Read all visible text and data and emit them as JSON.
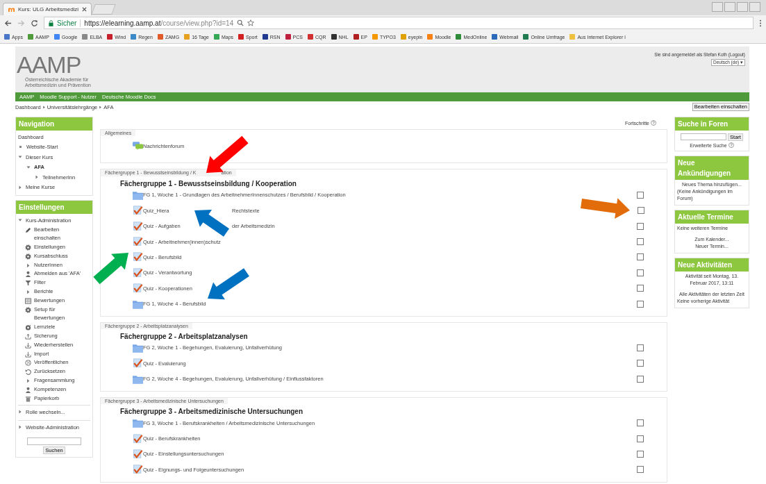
{
  "browser": {
    "tab_title": "Kurs: ULG Arbeitsmedizi",
    "secure_label": "Sicher",
    "url_host": "https://elearning.aamp.at",
    "url_path": "/course/view.php?id=14",
    "bookmarks": [
      {
        "label": "Apps",
        "color": "#4a76c8"
      },
      {
        "label": "AAMP",
        "color": "#4f9a3a"
      },
      {
        "label": "Google",
        "color": "#4285f4"
      },
      {
        "label": "ELBA",
        "color": "#888888"
      },
      {
        "label": "Wind",
        "color": "#c8202a"
      },
      {
        "label": "Regen",
        "color": "#3a8ac8"
      },
      {
        "label": "ZAMG",
        "color": "#e05a2a"
      },
      {
        "label": "16 Tage",
        "color": "#e8a020"
      },
      {
        "label": "Maps",
        "color": "#34a853"
      },
      {
        "label": "Sport",
        "color": "#d02020"
      },
      {
        "label": "RSN",
        "color": "#203a90"
      },
      {
        "label": "PCS",
        "color": "#c02040"
      },
      {
        "label": "CQR",
        "color": "#d03030"
      },
      {
        "label": "NHL",
        "color": "#333333"
      },
      {
        "label": "EP",
        "color": "#b02020"
      },
      {
        "label": "TYPO3",
        "color": "#f49700"
      },
      {
        "label": "eyepin",
        "color": "#e0a000"
      },
      {
        "label": "Moodle",
        "color": "#f98012"
      },
      {
        "label": "MedOnline",
        "color": "#2e8b3a"
      },
      {
        "label": "Webmail",
        "color": "#2a6ab8"
      },
      {
        "label": "Online Umfrage",
        "color": "#207a50"
      },
      {
        "label": "Aus Internet Explorer i",
        "color": "#f0c040"
      }
    ]
  },
  "header": {
    "logo_text": "AAMP",
    "logo_subtitle": "Österreichische Akademie für Arbeitsmedizin und Prävention",
    "login_info": "Sie sind angemeldet als Stefan Koth (Logout)",
    "language": "Deutsch (de) ▾"
  },
  "navbar": [
    "AAMP",
    "Moodle Support - Nutzer",
    "Deutsche Moodle Docs"
  ],
  "breadcrumb": [
    "Dashboard",
    "Universitätslehrgänge",
    "AFA"
  ],
  "edit_button": "Bearbeiten einschalten",
  "navigation": {
    "title": "Navigation",
    "items": [
      {
        "label": "Dashboard",
        "kind": "plain"
      },
      {
        "label": "Website-Start",
        "kind": "bullet"
      },
      {
        "label": "Dieser Kurs",
        "kind": "expanded",
        "children": [
          {
            "label": "AFA",
            "kind": "expanded",
            "bold": true,
            "children": [
              {
                "label": "TeilnehmerInn",
                "kind": "collapsed"
              }
            ]
          }
        ]
      },
      {
        "label": "Meine Kurse",
        "kind": "collapsed"
      }
    ]
  },
  "settings": {
    "title": "Einstellungen",
    "admin_label": "Kurs-Administration",
    "items": [
      {
        "label": "Bearbeiten einschalten",
        "kind": "pencil"
      },
      {
        "label": "Einstellungen",
        "kind": "gear"
      },
      {
        "label": "Kursabschluss",
        "kind": "gear"
      },
      {
        "label": "NutzerInnen",
        "kind": "collapsed"
      },
      {
        "label": "Abmelden aus 'AFA'",
        "kind": "user"
      },
      {
        "label": "Filter",
        "kind": "filter"
      },
      {
        "label": "Berichte",
        "kind": "collapsed"
      },
      {
        "label": "Bewertungen",
        "kind": "table"
      },
      {
        "label": "Setup für Bewertungen",
        "kind": "gear"
      },
      {
        "label": "Lernziele",
        "kind": "target"
      },
      {
        "label": "Sicherung",
        "kind": "upload"
      },
      {
        "label": "Wiederherstellen",
        "kind": "download"
      },
      {
        "label": "Import",
        "kind": "download"
      },
      {
        "label": "Veröffentlichen",
        "kind": "globe"
      },
      {
        "label": "Zurücksetzen",
        "kind": "reset"
      },
      {
        "label": "Fragensammlung",
        "kind": "collapsed"
      },
      {
        "label": "Kompetenzen",
        "kind": "user"
      },
      {
        "label": "Papierkorb",
        "kind": "trash"
      }
    ],
    "footer_items": [
      "Rolle wechseln...",
      "Website-Administration"
    ],
    "search_button": "Suchen"
  },
  "progress_label": "Fortschritte",
  "sections": [
    {
      "label": "Allgemeines",
      "activities": [
        {
          "kind": "forum",
          "label": "Nachrichtenforum"
        }
      ]
    },
    {
      "label": "Fächergruppe 1 - Bewusstseinsbildung / K",
      "label_after": "ation",
      "arrows": [
        {
          "kind": "gap",
          "color": "#ff0000"
        }
      ],
      "heading": "Fächergruppe 1 - Bewusstseinsbildung / Kooperation",
      "activities": [
        {
          "kind": "folder",
          "label": "FG 1, Woche 1 - Grundlagen des ArbeitnehmerInnenschutzes / Berufsbild / Kooperation",
          "checked": false
        },
        {
          "kind": "quiz",
          "label": "Quiz_Hiera",
          "label_after": "Rechtstexte",
          "checked": false,
          "arrows": [
            {
              "kind": "gap",
              "color": "#0070c0"
            },
            {
              "kind": "checkbox",
              "color": "#e36c0a"
            }
          ]
        },
        {
          "kind": "quiz",
          "label": "Quiz - Aufgaben",
          "label_after": "der Arbeitsmedizin",
          "checked": false
        },
        {
          "kind": "quiz",
          "label": "Quiz - Arbeitnehmer(innen)schutz",
          "checked": false
        },
        {
          "kind": "quiz",
          "label": "Quiz - Berufsbild",
          "checked": false,
          "arrows": [
            {
              "kind": "icon",
              "color": "#00b050"
            }
          ]
        },
        {
          "kind": "quiz",
          "label": "Quiz - Verantwortung",
          "checked": false
        },
        {
          "kind": "quiz",
          "label": "Quiz - Kooperationen",
          "checked": false
        },
        {
          "kind": "folder",
          "label": "FG 1, Woche 4 - Berufsbild",
          "checked": false,
          "arrows": [
            {
              "kind": "end",
              "color": "#0070c0"
            }
          ]
        }
      ]
    },
    {
      "label": "Fächergruppe 2 - Arbeitsplatzanalysen",
      "heading": "Fächergruppe 2 - Arbeitsplatzanalysen",
      "activities": [
        {
          "kind": "folder",
          "label": "FG 2, Woche 1 - Begehungen, Evaluierung, Unfallverhütung",
          "checked": false
        },
        {
          "kind": "quiz",
          "label": "Quiz - Evaluierung",
          "checked": false
        },
        {
          "kind": "folder",
          "label": "FG 2, Woche 4 - Begehungen, Evaluierung, Unfallverhütung / Einflussfaktoren",
          "checked": false
        }
      ]
    },
    {
      "label": "Fächergruppe 3 - Arbeitsmedizinische Untersuchungen",
      "heading": "Fächergruppe 3 - Arbeitsmedizinische Untersuchungen",
      "activities": [
        {
          "kind": "folder",
          "label": "FG 3, Woche 1 - Berufskrankheiten / Arbeitsmedizinische Untersuchungen",
          "checked": false
        },
        {
          "kind": "quiz",
          "label": "Quiz - Berufskrankheiten",
          "checked": false
        },
        {
          "kind": "quiz",
          "label": "Quiz - Einstellungsuntersuchungen",
          "checked": false
        },
        {
          "kind": "quiz",
          "label": "Quiz - Eignungs- und Folgeuntersuchungen",
          "checked": false
        }
      ]
    }
  ],
  "forum_search": {
    "title": "Suche in Foren",
    "button": "Start",
    "advanced": "Erweiterte Suche"
  },
  "announcements": {
    "title": "Neue Ankündigungen",
    "add": "Neues Thema hinzufügen...",
    "empty": "(Keine Ankündigungen im Forum)"
  },
  "events": {
    "title": "Aktuelle Termine",
    "empty": "Keine weiteren Termine",
    "calendar": "Zum Kalender...",
    "new_event": "Neuer Termin..."
  },
  "activity": {
    "title": "Neue Aktivitäten",
    "since": "Aktivität seit Montag, 13. Februar 2017, 13:11",
    "all": "Alle Aktivitäten der letzten Zeit",
    "none": "Keine vorherige Aktivität"
  }
}
